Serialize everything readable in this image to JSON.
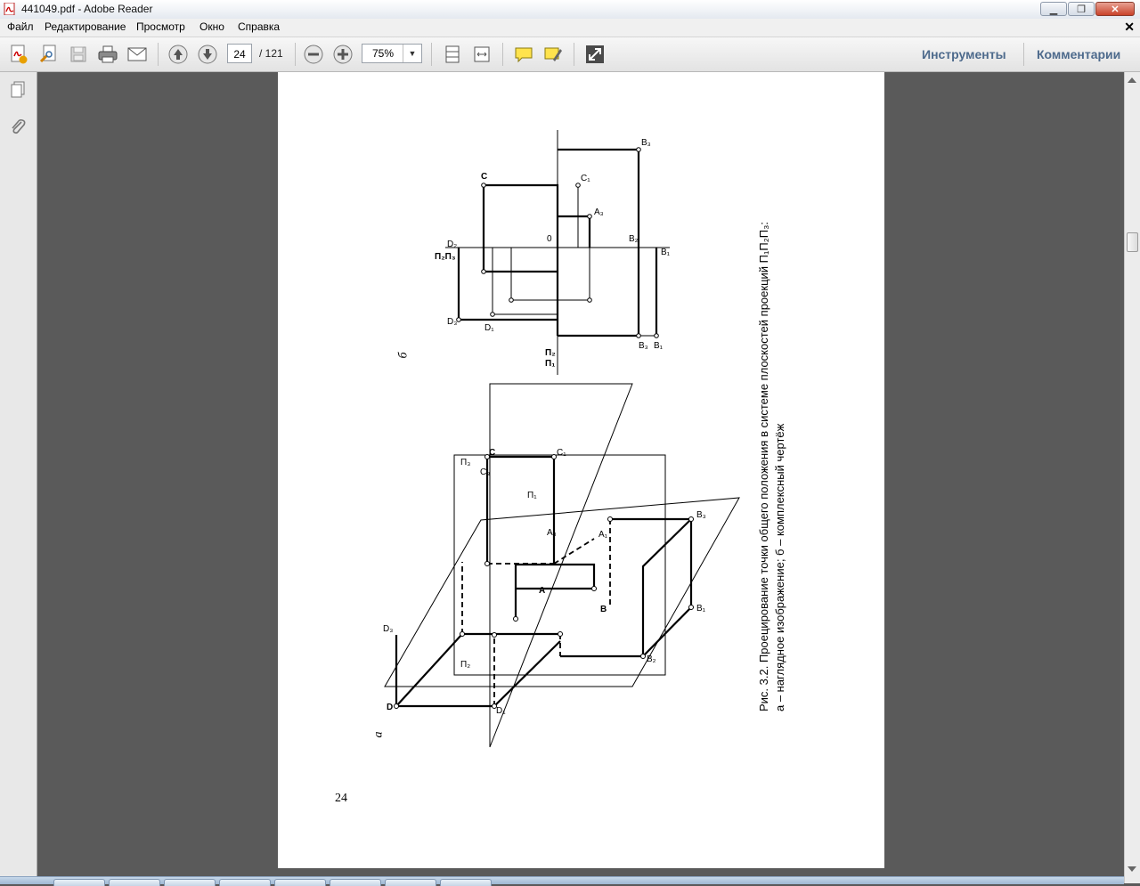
{
  "window": {
    "title": "441049.pdf - Adobe Reader"
  },
  "menu": {
    "items": [
      "Файл",
      "Редактирование",
      "Просмотр",
      "Окно",
      "Справка"
    ]
  },
  "toolbar": {
    "page_current": "24",
    "page_total": "/  121",
    "zoom": "75%",
    "tools_label": "Инструменты",
    "comments_label": "Комментарии"
  },
  "document": {
    "page_number": "24",
    "label_a": "а",
    "label_b": "б",
    "caption_line1": "Рис. 3.2. Проецирование точки общего положения в системе плоскостей проекций П₁П₂П₃:",
    "caption_line2": "а – наглядное изображение; б – комплексный чертёж"
  },
  "colors": {
    "accent": "#4d6a8c",
    "page_bg": "#5a5a5a"
  }
}
